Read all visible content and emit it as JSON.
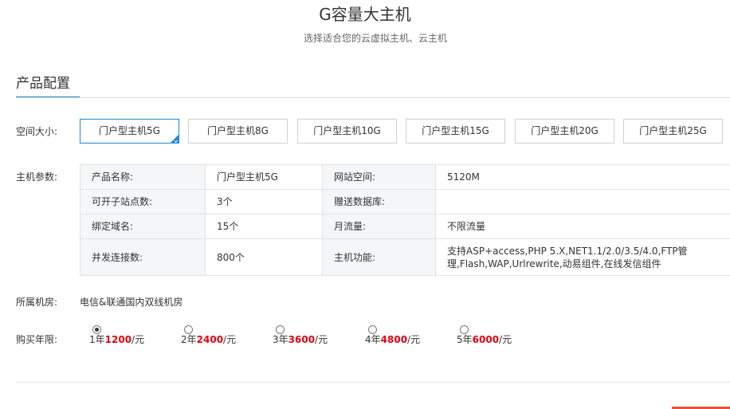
{
  "header": {
    "title": "G容量大主机",
    "subtitle": "选择适合您的云虚拟主机、云主机"
  },
  "section": {
    "tab_label": "产品配置"
  },
  "space": {
    "label": "空间大小:",
    "options": [
      "门户型主机5G",
      "门户型主机8G",
      "门户型主机10G",
      "门户型主机15G",
      "门户型主机20G",
      "门户型主机25G"
    ],
    "selected_index": 0
  },
  "params": {
    "label": "主机参数:",
    "rows": [
      [
        "产品名称:",
        "门户型主机5G",
        "网站空间:",
        "5120M"
      ],
      [
        "可开子站点数:",
        "3个",
        "赠送数据库:",
        ""
      ],
      [
        "绑定域名:",
        "15个",
        "月流量:",
        "不限流量"
      ],
      [
        "并发连接数:",
        "800个",
        "主机功能:",
        "支持ASP+access,PHP 5.X,NET1.1/2.0/3.5/4.0,FTP管理,Flash,WAP,Urlrewrite,动易组件,在线发信组件"
      ]
    ]
  },
  "room": {
    "label": "所属机房:",
    "value": "电信&联通国内双线机房"
  },
  "period": {
    "label": "购买年限:",
    "options": [
      {
        "years": "1年",
        "price": "1200",
        "unit": "/元",
        "selected": true
      },
      {
        "years": "2年",
        "price": "2400",
        "unit": "/元",
        "selected": false
      },
      {
        "years": "3年",
        "price": "3600",
        "unit": "/元",
        "selected": false
      },
      {
        "years": "4年",
        "price": "4800",
        "unit": "/元",
        "selected": false
      },
      {
        "years": "5年",
        "price": "6000",
        "unit": "/元",
        "selected": false
      }
    ]
  },
  "colors": {
    "accent": "#1c8ad8",
    "price": "#e60012",
    "table_key_bg": "#f5f6f8"
  }
}
